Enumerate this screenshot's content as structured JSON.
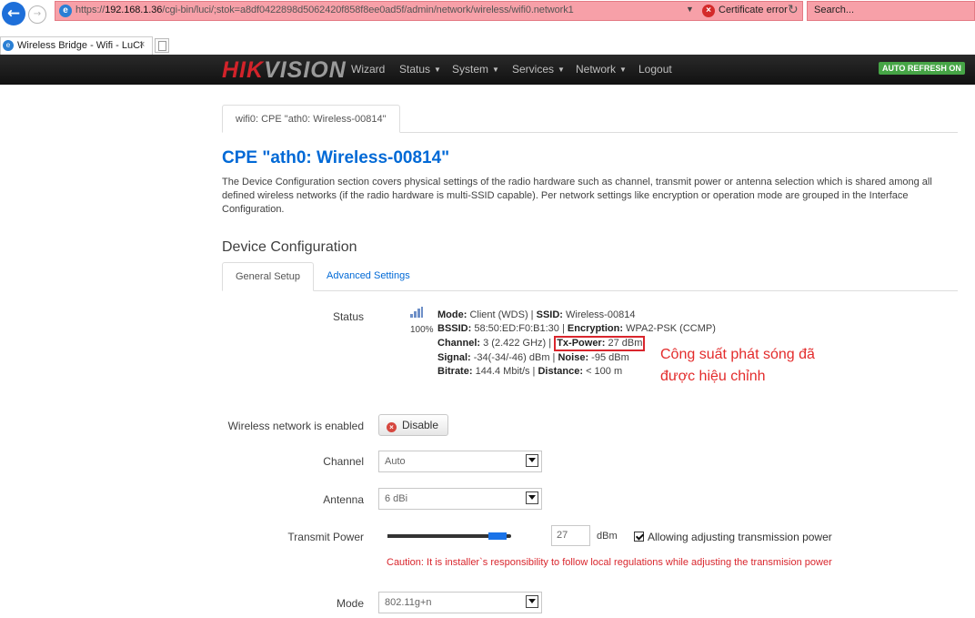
{
  "browser": {
    "url_prefix": "https://",
    "url_host": "192.168.1.36",
    "url_path": "/cgi-bin/luci/;stok=a8df0422898d5062420f858f8ee0ad5f/admin/network/wireless/wifi0.network1",
    "cert_error": "Certificate error",
    "search_placeholder": "Search...",
    "tab_title": "Wireless Bridge - Wifi - LuCI"
  },
  "nav": {
    "brand_a": "HIK",
    "brand_b": "VISION",
    "items": [
      "Wizard",
      "Status",
      "System",
      "Services",
      "Network",
      "Logout"
    ],
    "auto_refresh": "AUTO REFRESH ON"
  },
  "page": {
    "breadcrumb_tab": "wifi0: CPE \"ath0: Wireless-00814\"",
    "title": "CPE \"ath0: Wireless-00814\"",
    "description": "The Device Configuration section covers physical settings of the radio hardware such as channel, transmit power or antenna selection which is shared among all defined wireless networks (if the radio hardware is multi-SSID capable). Per network settings like encryption or operation mode are grouped in the Interface Configuration.",
    "section_title": "Device Configuration",
    "tabs": [
      "General Setup",
      "Advanced Settings"
    ]
  },
  "status": {
    "label": "Status",
    "signal_percent": "100%",
    "mode_k": "Mode:",
    "mode_v": "Client (WDS)",
    "ssid_k": "SSID:",
    "ssid_v": "Wireless-00814",
    "bssid_k": "BSSID:",
    "bssid_v": "58:50:ED:F0:B1:30",
    "enc_k": "Encryption:",
    "enc_v": "WPA2-PSK (CCMP)",
    "channel_k": "Channel:",
    "channel_v": "3 (2.422 GHz)",
    "txpower_k": "Tx-Power:",
    "txpower_v": "27 dBm",
    "signal_k": "Signal:",
    "signal_v": "-34(-34/-46) dBm",
    "noise_k": "Noise:",
    "noise_v": "-95 dBm",
    "bitrate_k": "Bitrate:",
    "bitrate_v": "144.4 Mbit/s",
    "distance_k": "Distance:",
    "distance_v": "< 100 m"
  },
  "annotation": {
    "line1": "Công suất phát sóng đã",
    "line2": "được hiệu chỉnh"
  },
  "form": {
    "enabled_label": "Wireless network is enabled",
    "disable_button": "Disable",
    "channel_label": "Channel",
    "channel_value": "Auto",
    "antenna_label": "Antenna",
    "antenna_value": "6 dBi",
    "txpower_label": "Transmit Power",
    "txpower_value": "27",
    "txpower_slider_fraction": 0.96,
    "txpower_unit": "dBm",
    "allow_adjust_label": "Allowing adjusting transmission power",
    "allow_adjust_checked": true,
    "caution": "Caution: It is installer`s responsibility to follow local regulations while adjusting the transmision power",
    "mode_label": "Mode",
    "mode_value": "802.11g+n"
  },
  "colors": {
    "brand_red": "#d2232a",
    "link_blue": "#0069d6",
    "annotation_red": "#e32b2b",
    "refresh_green": "#46a546"
  }
}
